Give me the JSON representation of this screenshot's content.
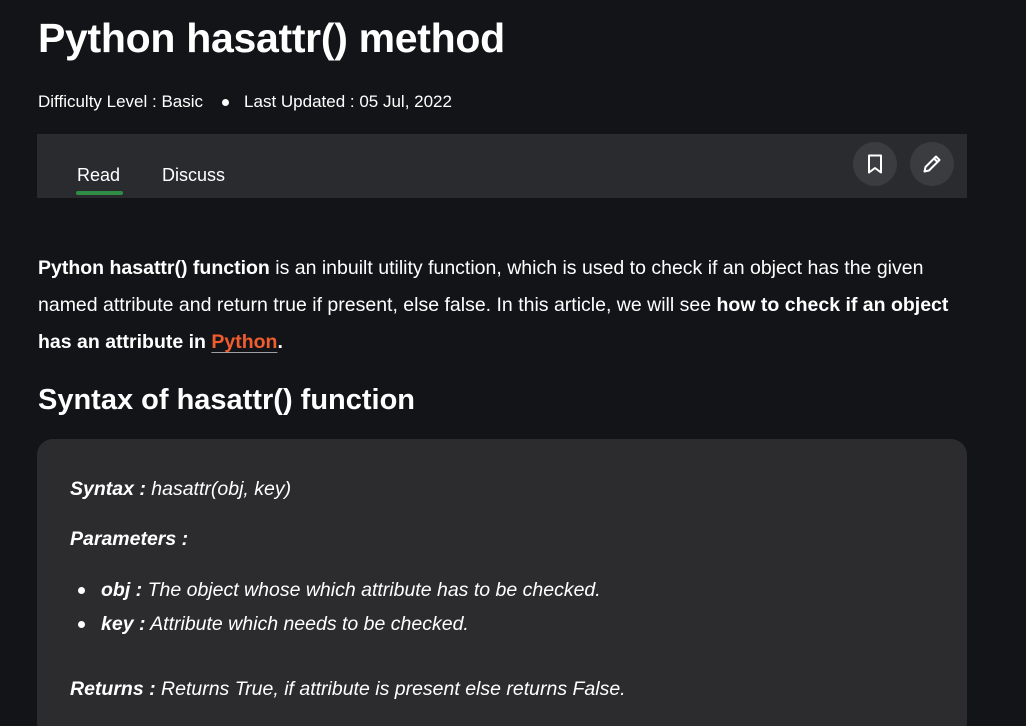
{
  "article": {
    "title": "Python hasattr() method",
    "difficulty_label": "Difficulty Level : Basic",
    "updated_label": "Last Updated : 05 Jul, 2022"
  },
  "tabs": {
    "read": "Read",
    "discuss": "Discuss",
    "active": "Read"
  },
  "actions": {
    "bookmark_icon": "bookmark-icon",
    "edit_icon": "pencil-icon"
  },
  "intro": {
    "bold_lead": "Python hasattr() function",
    "text_1": " is an inbuilt utility function, which is used to check if an object has the given named attribute and return true if present, else false. In this article, we will see ",
    "bold_tail": "how to check if an object has an attribute in ",
    "link_text": "Python",
    "end": "."
  },
  "section": {
    "heading": "Syntax of hasattr() function"
  },
  "syntax_box": {
    "syntax_label": "Syntax :",
    "syntax_value": " hasattr(obj, key)",
    "parameters_label": "Parameters :",
    "parameters": [
      {
        "name": "obj :",
        "desc": " The object whose which attribute has to be checked."
      },
      {
        "name": "key :",
        "desc": " Attribute which needs to be checked."
      }
    ],
    "returns_label": "Returns :",
    "returns_value": " Returns True, if attribute is present else returns False."
  },
  "colors": {
    "background": "#131417",
    "tabbar": "#2a2b2e",
    "active_tab_indicator": "#2f8d46",
    "link": "#f25d2f",
    "card": "#2c2c2f"
  }
}
